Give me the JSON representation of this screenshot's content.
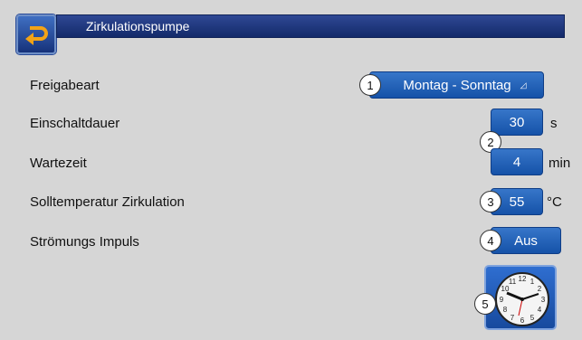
{
  "header": {
    "title": "Zirkulationspumpe",
    "back_icon": "back-arrow-icon"
  },
  "rows": {
    "freigabeart": {
      "label": "Freigabeart",
      "value": "Montag - Sonntag",
      "marker": "1"
    },
    "einschaltdauer": {
      "label": "Einschaltdauer",
      "value": "30",
      "unit": "s",
      "marker": "2"
    },
    "wartezeit": {
      "label": "Wartezeit",
      "value": "4",
      "unit": "min"
    },
    "solltemperatur": {
      "label": "Solltemperatur Zirkulation",
      "value": "55",
      "unit": "°C",
      "marker": "3"
    },
    "stroemung": {
      "label": "Strömungs Impuls",
      "value": "Aus",
      "marker": "4"
    }
  },
  "clock": {
    "icon": "clock-icon",
    "marker": "5"
  },
  "colors": {
    "accent": "#1f5fb8",
    "header": "#1a3278",
    "background": "#d6d6d6"
  }
}
